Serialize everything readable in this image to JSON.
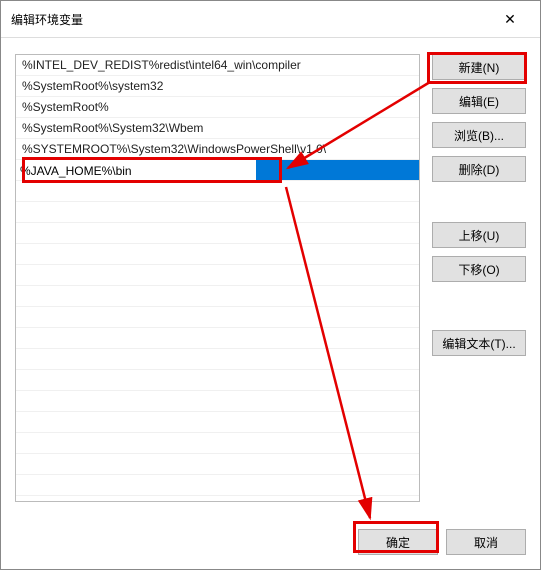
{
  "dialog": {
    "title": "编辑环境变量"
  },
  "items": [
    "%INTEL_DEV_REDIST%redist\\intel64_win\\compiler",
    "%SystemRoot%\\system32",
    "%SystemRoot%",
    "%SystemRoot%\\System32\\Wbem",
    "%SYSTEMROOT%\\System32\\WindowsPowerShell\\v1.0\\"
  ],
  "editing_value": "%JAVA_HOME%\\bin",
  "buttons": {
    "new": "新建(N)",
    "edit": "编辑(E)",
    "browse": "浏览(B)...",
    "delete": "删除(D)",
    "moveup": "上移(U)",
    "movedown": "下移(O)",
    "edittext": "编辑文本(T)...",
    "ok": "确定",
    "cancel": "取消"
  }
}
